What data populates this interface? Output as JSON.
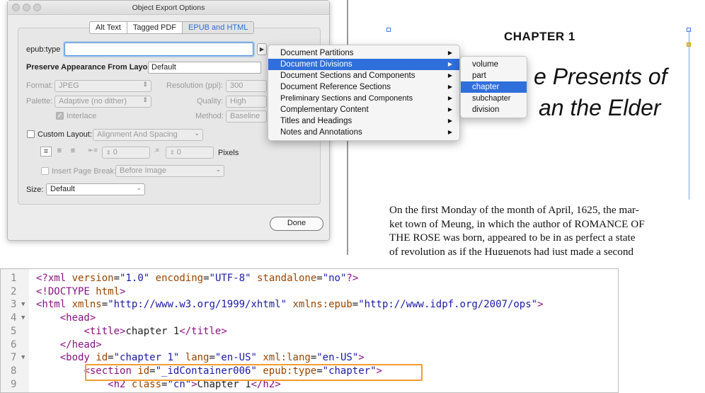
{
  "dialog": {
    "title": "Object Export Options",
    "tabs": [
      {
        "label": "Alt Text",
        "active": false
      },
      {
        "label": "Tagged PDF",
        "active": false
      },
      {
        "label": "EPUB and HTML",
        "active": true
      }
    ],
    "epub_type": {
      "label": "epub:type",
      "value": ""
    },
    "preserve": {
      "label": "Preserve Appearance From Layout:",
      "value": "Default"
    },
    "format": {
      "label": "Format:",
      "value": "JPEG"
    },
    "resolution": {
      "label": "Resolution (ppi):",
      "value": "300"
    },
    "palette": {
      "label": "Palette:",
      "value": "Adaptive (no dither)"
    },
    "quality": {
      "label": "Quality:",
      "value": "High"
    },
    "interlace": {
      "label": "Interlace",
      "checked": true
    },
    "method": {
      "label": "Method:",
      "value": "Baseline"
    },
    "custom_layout": {
      "label": "Custom Layout:",
      "value": "Alignment And Spacing",
      "checked": false
    },
    "spacing_before": "0",
    "spacing_after": "0",
    "pixels_label": "Pixels",
    "page_break": {
      "label": "Insert Page Break:",
      "value": "Before Image",
      "checked": false
    },
    "size": {
      "label": "Size:",
      "value": "Default"
    },
    "done_label": "Done"
  },
  "menu": {
    "items": [
      {
        "label": "Document Partitions",
        "highlighted": false
      },
      {
        "label": "Document Divisions",
        "highlighted": true
      },
      {
        "label": "Document Sections and Components",
        "highlighted": false
      },
      {
        "label": "Document Reference Sections",
        "highlighted": false
      },
      {
        "label": "Preliminary Sections and Components",
        "highlighted": false
      },
      {
        "label": "Complementary Content",
        "highlighted": false
      },
      {
        "label": "Titles and Headings",
        "highlighted": false
      },
      {
        "label": "Notes and Annotations",
        "highlighted": false
      }
    ],
    "submenu": [
      {
        "label": "volume",
        "highlighted": false
      },
      {
        "label": "part",
        "highlighted": false
      },
      {
        "label": "chapter",
        "highlighted": true
      },
      {
        "label": "subchapter",
        "highlighted": false
      },
      {
        "label": "division",
        "highlighted": false
      }
    ]
  },
  "document": {
    "chapter_heading": "CHAPTER 1",
    "title_line1_visible": "e Presents of",
    "title_line2_visible": "an the Elder",
    "body_lines": [
      "On the first Monday of the month of April, 1625, the mar-",
      "ket town of Meung, in which the author of ROMANCE OF",
      "THE ROSE was born, appeared to be in as perfect a state",
      "of revolution as if the Huguenots had just made a second"
    ]
  },
  "code": {
    "lines": [
      {
        "n": "1",
        "text": "<?xml version=\"1.0\" encoding=\"UTF-8\" standalone=\"no\"?>"
      },
      {
        "n": "2",
        "text": "<!DOCTYPE html>"
      },
      {
        "n": "3",
        "text": "<html xmlns=\"http://www.w3.org/1999/xhtml\" xmlns:epub=\"http://www.idpf.org/2007/ops\">"
      },
      {
        "n": "4",
        "text": "    <head>"
      },
      {
        "n": "5",
        "text": "        <title>chapter 1</title>"
      },
      {
        "n": "6",
        "text": "    </head>"
      },
      {
        "n": "7",
        "text": "    <body id=\"chapter 1\" lang=\"en-US\" xml:lang=\"en-US\">"
      },
      {
        "n": "8",
        "text": "        <section id=\"_idContainer006\" epub:type=\"chapter\">"
      },
      {
        "n": "9",
        "text": "            <h2 class=\"cn\">Chapter 1</h2>"
      }
    ],
    "highlight_color": "#f39c2f"
  }
}
